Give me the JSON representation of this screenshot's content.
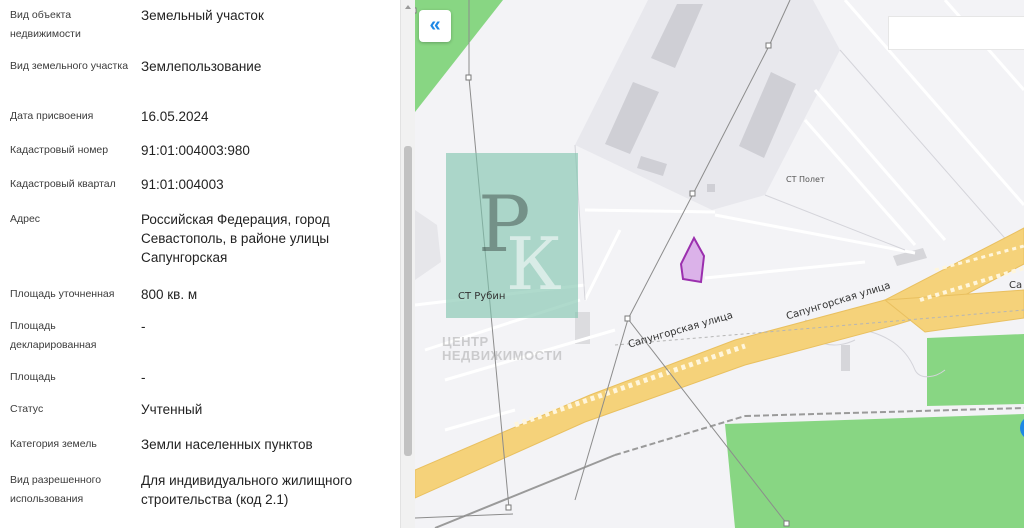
{
  "properties": [
    {
      "label": "Вид объекта недвижимости",
      "value": "Земельный участок"
    },
    {
      "label": "Вид земельного участка",
      "value": "Землепользование"
    },
    {
      "label": "Дата присвоения",
      "value": "16.05.2024"
    },
    {
      "label": "Кадастровый номер",
      "value": "91:01:004003:980"
    },
    {
      "label": "Кадастровый квартал",
      "value": "91:01:004003"
    },
    {
      "label": "Адрес",
      "value": "Российская Федерация, город Севастополь, в районе улицы Сапунгорская"
    },
    {
      "label": "Площадь уточненная",
      "value": "800 кв. м"
    },
    {
      "label": "Площадь декларированная",
      "value": "-"
    },
    {
      "label": "Площадь",
      "value": "-"
    },
    {
      "label": "Статус",
      "value": "Учтенный"
    },
    {
      "label": "Категория земель",
      "value": "Земли населенных пунктов"
    },
    {
      "label": "Вид разрешенного использования",
      "value": "Для индивидуального жилищного строительства (код 2.1)"
    }
  ],
  "map": {
    "collapse_button": {
      "icon": "double-chevron-left-icon",
      "glyph": "«"
    },
    "search": {
      "value": "",
      "placeholder": ""
    },
    "labels": {
      "st_polet": "СТ Полет",
      "st_rubin": "СТ Рубин",
      "street_1": "Сапунгорская улица",
      "street_2": "Сапунгорская улица",
      "street_3": "Са"
    },
    "watermark": {
      "logo": "РК",
      "caption_line1": "ЦЕНТР",
      "caption_line2": "НЕДВИЖИМОСТИ"
    },
    "colors": {
      "background": "#f3f3f6",
      "road": "#f5d27a",
      "greenery": "#88d683",
      "building": "#d9d9df",
      "parcel_fill": "#d6a6e6",
      "parcel_stroke": "#9b2fae",
      "watermark": "#7ec4ac"
    }
  }
}
